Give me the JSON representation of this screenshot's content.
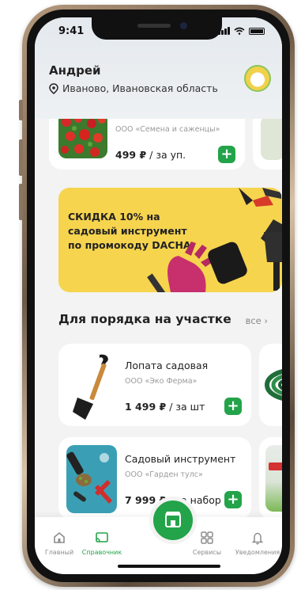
{
  "status": {
    "time": "9:41"
  },
  "header": {
    "user_name": "Андрей",
    "location": "Иваново, Ивановская область"
  },
  "top_product": {
    "seller": "ООО «Семена и саженцы»",
    "price": "499 ₽",
    "unit": "/ за уп."
  },
  "promo": {
    "text": "СКИДКА 10% на садовый инструмент по промокоду DACHA"
  },
  "section": {
    "title": "Для порядка на участке",
    "all_label": "все ›"
  },
  "products": [
    {
      "title": "Лопата садовая",
      "seller": "ООО «Эко Ферма»",
      "price": "1 499 ₽",
      "unit": "/ за шт"
    },
    {
      "title": "Садовый инструмент",
      "seller": "ООО «Гарден тулс»",
      "price": "7 999 ₽",
      "unit": "/ за набор"
    }
  ],
  "tabs": [
    {
      "label": "Главный",
      "icon": "home-icon"
    },
    {
      "label": "Справочник",
      "icon": "cast-icon"
    },
    {
      "label": "Сервисы",
      "icon": "grid-icon"
    },
    {
      "label": "Уведомления",
      "icon": "bell-icon"
    }
  ],
  "colors": {
    "accent": "#23a34a",
    "promo_bg": "#f6d44e"
  }
}
